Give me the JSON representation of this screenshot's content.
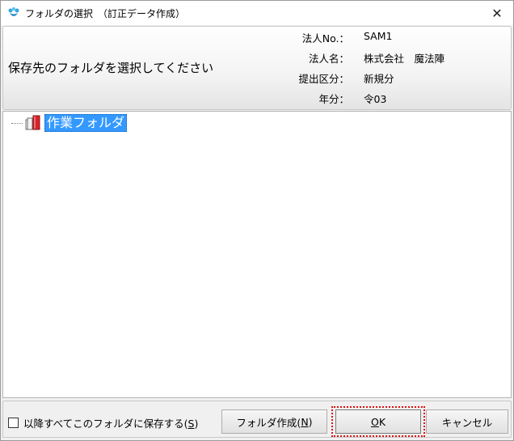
{
  "window": {
    "title": "フォルダの選択　（訂正データ作成）",
    "close_label": "✕"
  },
  "header": {
    "instruction": "保存先のフォルダを選択してください",
    "rows": [
      {
        "label": "法人No.：",
        "value": "SAM1"
      },
      {
        "label": "法人名：",
        "value": "株式会社　魔法陣"
      },
      {
        "label": "提出区分：",
        "value": "新規分"
      },
      {
        "label": "年分：",
        "value": "令03"
      }
    ]
  },
  "tree": {
    "nodes": [
      {
        "label": "作業フォルダ",
        "selected": true
      }
    ]
  },
  "footer": {
    "checkbox_label_pre": "以降すべてこのフォルダに保存する(",
    "checkbox_key": "S",
    "checkbox_label_post": ")",
    "checkbox_checked": false,
    "create_folder_pre": "フォルダ作成(",
    "create_folder_key": "N",
    "create_folder_post": ")",
    "ok_label": "OK",
    "ok_key": "O",
    "ok_rest": "K",
    "cancel_label": "キャンセル"
  },
  "colors": {
    "selection": "#3399ff",
    "focus_frame": "#e01010"
  }
}
